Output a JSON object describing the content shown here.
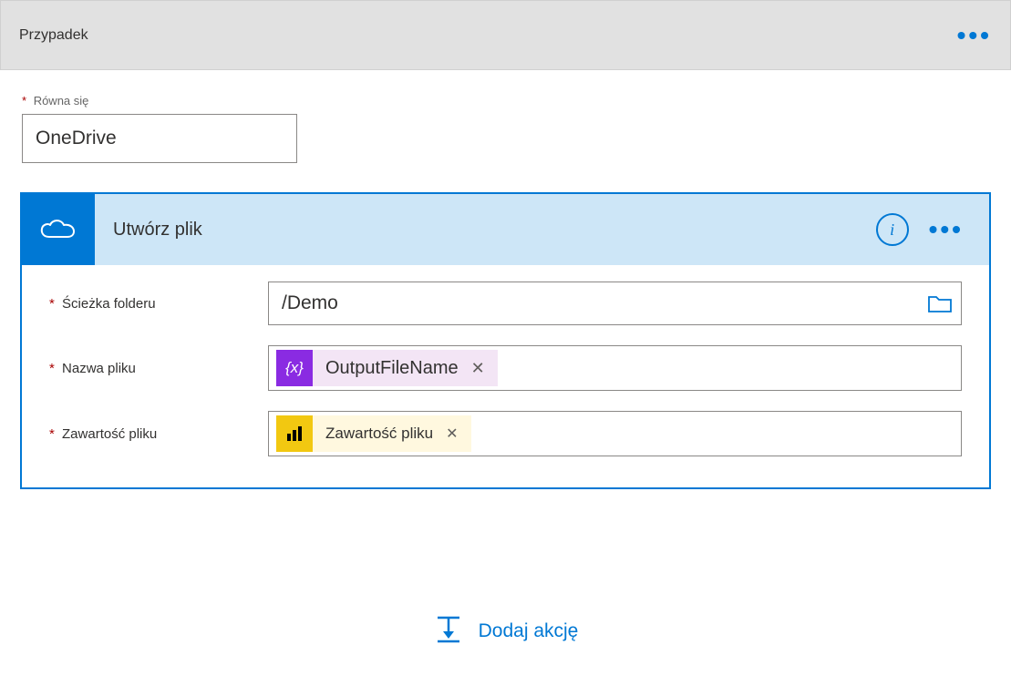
{
  "case": {
    "title": "Przypadek"
  },
  "equals": {
    "label": "Równa się",
    "value": "OneDrive"
  },
  "action": {
    "title": "Utwórz plik",
    "fields": {
      "folderPath": {
        "label": "Ścieżka folderu",
        "value": "/Demo"
      },
      "fileName": {
        "label": "Nazwa pliku",
        "token": "OutputFileName"
      },
      "fileContent": {
        "label": "Zawartość pliku",
        "token": "Zawartość pliku"
      }
    }
  },
  "addAction": {
    "label": "Dodaj akcję"
  },
  "icons": {
    "varBrace": "{x}",
    "info": "i"
  }
}
